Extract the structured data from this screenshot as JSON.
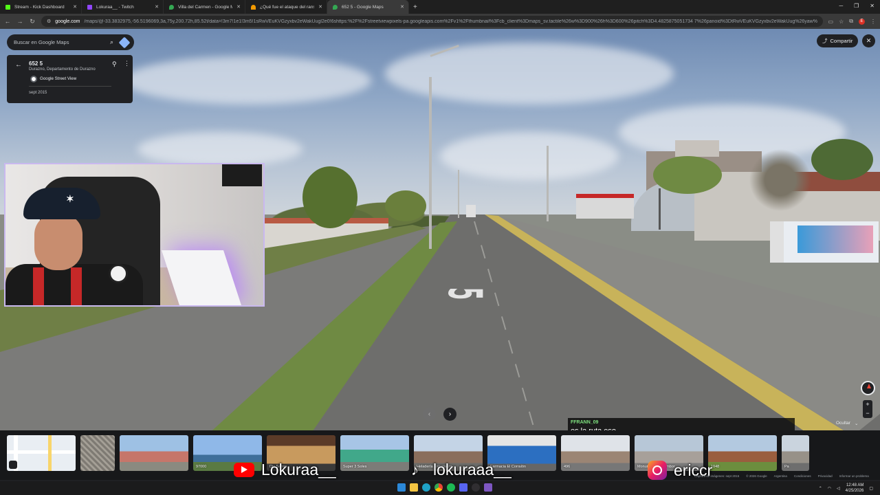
{
  "tabs": [
    {
      "label": "Stream - Kick Dashboard",
      "color": "#53fc18"
    },
    {
      "label": "Lokuraa__ - Twitch",
      "color": "#9146ff"
    },
    {
      "label": "Villa del Carmen - Google Maps",
      "color": "#34a853"
    },
    {
      "label": "¿Qué fue el ataque del ransom...",
      "color": "#f29900"
    },
    {
      "label": "652 5 - Google Maps",
      "color": "#34a853"
    }
  ],
  "address_bar": {
    "host": "google.com",
    "path": "/maps/@-33.3832975,-56.5196069,3a,75y,200.72h,85.52t/data=!3m7!1e1!3m5!1sRwVEuKVGzyxbv2eWakUugl2e0!6shttps:%2F%2Fstreetviewpixels-pa.googleapis.com%2Fv1%2Fthumbnail%3Fcb_client%3Dmaps_sv.tactile%26w%3D900%26h%3D600%26pitch%3D4.4825875051734 7%26panoid%3DtRwVEuKVGzyxbv2eWakUug%26yaw%3D200..."
  },
  "search": {
    "placeholder": "Buscar en Google Maps"
  },
  "location_card": {
    "address": "652 5",
    "region": "Durazno, Departamento de Durazno",
    "provider": "Google Street View",
    "date": "sept 2015"
  },
  "controls": {
    "share_label": "Compartir",
    "hide_label": "Ocultar"
  },
  "road_marking": "5",
  "chat": {
    "user": "FFRANN_09",
    "message": "es la ruta eso"
  },
  "thumbnails": [
    {
      "label": ""
    },
    {
      "label": ""
    },
    {
      "label": ""
    },
    {
      "label": "97000"
    },
    {
      "label": "Dis Sanso"
    },
    {
      "label": "Super 3 Soles"
    },
    {
      "label": "Heladería Esperanza"
    },
    {
      "label": "Farmacia El Corralón"
    },
    {
      "label": "496"
    },
    {
      "label": "Monumento al Tambor"
    },
    {
      "label": "1048"
    },
    {
      "label": "Pa"
    }
  ],
  "social": {
    "youtube": "Lokuraa__",
    "tiktok": "lokuraaa__",
    "instagram": "ericcr"
  },
  "footer_links": [
    "Captura de imágenes: sept 2015",
    "© 2026 Google",
    "Argentina",
    "Condiciones",
    "Privacidad",
    "Informar un problema"
  ],
  "taskbar": {
    "time": "12:48 AM",
    "date": "4/25/2026"
  },
  "icons": [
    "search-icon",
    "directions-icon",
    "back-arrow-icon",
    "pin-icon",
    "more-vert-icon",
    "share-icon",
    "close-icon",
    "compass-icon",
    "zoom-in-icon",
    "zoom-out-icon",
    "youtube-icon",
    "tiktok-icon",
    "instagram-icon"
  ]
}
